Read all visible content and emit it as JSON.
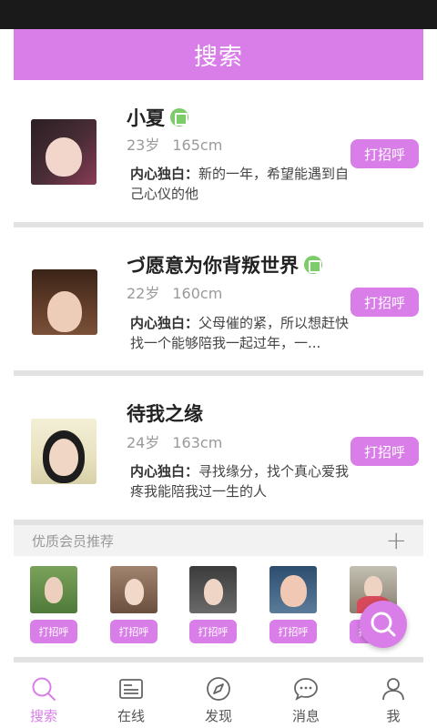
{
  "header": {
    "title": "搜索"
  },
  "accent_color": "#d97ee8",
  "users": [
    {
      "name": "小夏",
      "verified": true,
      "age": "23岁",
      "height": "165cm",
      "bio_label": "内心独白：",
      "bio_text": "新的一年，希望能遇到自己心仪的他",
      "call_label": "打招呼",
      "avatar": "young-woman-dark-hair-avatar"
    },
    {
      "name": "づ愿意为你背叛世界",
      "verified": true,
      "age": "22岁",
      "height": "160cm",
      "bio_label": "内心独白：",
      "bio_text": "父母催的紧，所以想赶快找一个能够陪我一起过年，一...",
      "call_label": "打招呼",
      "avatar": "young-woman-bangs-avatar"
    },
    {
      "name": "待我之缘",
      "verified": false,
      "age": "24岁",
      "height": "163cm",
      "bio_label": "内心独白：",
      "bio_text": "寻找缘分，找个真心爱我疼我能陪我过一生的人",
      "call_label": "打招呼",
      "avatar": "woman-light-background-avatar"
    }
  ],
  "premium": {
    "title": "优质会员推荐",
    "members": [
      {
        "call_label": "打招呼",
        "avatar": "woman-outdoor-avatar"
      },
      {
        "call_label": "打招呼",
        "avatar": "woman-long-hair-avatar"
      },
      {
        "call_label": "打招呼",
        "avatar": "woman-in-car-avatar"
      },
      {
        "call_label": "打招呼",
        "avatar": "woman-closeup-avatar"
      },
      {
        "call_label": "打招呼",
        "avatar": "woman-red-dress-avatar"
      }
    ]
  },
  "tabs": [
    {
      "label": "搜索",
      "icon": "search-icon",
      "active": true
    },
    {
      "label": "在线",
      "icon": "id-card-icon",
      "active": false
    },
    {
      "label": "发现",
      "icon": "compass-icon",
      "active": false
    },
    {
      "label": "消息",
      "icon": "chat-bubble-icon",
      "active": false
    },
    {
      "label": "我",
      "icon": "person-icon",
      "active": false
    }
  ]
}
